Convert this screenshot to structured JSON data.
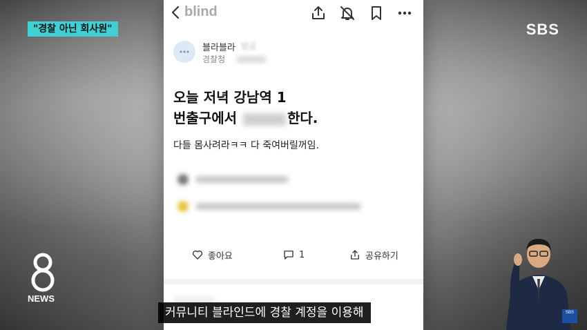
{
  "broadcast": {
    "caption_tag": "\"경찰 아닌 회사원\"",
    "channel_logo": "SBS",
    "program_number": "8",
    "program_label": "NEWS",
    "subtitle": "커뮤니티 블라인드에 경찰 계정을 이용해",
    "corner_logo": "SBS"
  },
  "app": {
    "brand": "blind",
    "toolbar_icons": [
      "back-icon",
      "share-icon",
      "notification-off-icon",
      "bookmark-icon",
      "more-icon"
    ]
  },
  "post": {
    "author_name": "블라블라",
    "author_time": "방금",
    "author_org": "경찰청",
    "title_line1": "오늘 저녁 강남역 1",
    "title_line2_prefix": "번출구에서",
    "title_line2_suffix": "한다.",
    "body": "다들 몸사려라ㅋㅋ 다 죽여버릴꺼임.",
    "actions": {
      "like_label": "좋아요",
      "comment_count": "1",
      "share_label": "공유하기"
    }
  },
  "colors": {
    "caption_bg": "#3fd0d6",
    "subtitle_bg": "#000000"
  }
}
